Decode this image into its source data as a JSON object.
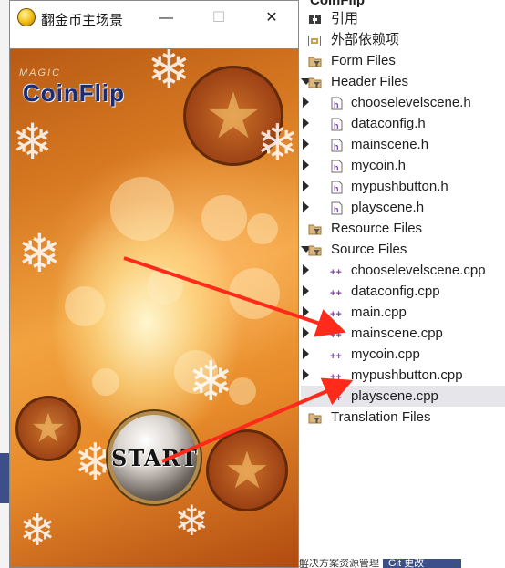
{
  "window": {
    "title": "翻金币主场景",
    "minimize": "—",
    "maximize": "☐",
    "close": "✕"
  },
  "scene": {
    "logo_top": "MAGIC",
    "logo": "CoinFlip",
    "start_button": "START"
  },
  "explorer": {
    "project": "CoinFlip",
    "items": [
      {
        "label": "引用",
        "icon": "references-icon"
      },
      {
        "label": "外部依赖项",
        "icon": "external-deps-icon"
      },
      {
        "label": "Form Files",
        "icon": "filter-folder-icon"
      },
      {
        "label": "Header Files",
        "icon": "filter-folder-icon"
      },
      {
        "label": "chooselevelscene.h",
        "icon": "header-file-icon"
      },
      {
        "label": "dataconfig.h",
        "icon": "header-file-icon"
      },
      {
        "label": "mainscene.h",
        "icon": "header-file-icon"
      },
      {
        "label": "mycoin.h",
        "icon": "header-file-icon"
      },
      {
        "label": "mypushbutton.h",
        "icon": "header-file-icon"
      },
      {
        "label": "playscene.h",
        "icon": "header-file-icon"
      },
      {
        "label": "Resource Files",
        "icon": "filter-folder-icon"
      },
      {
        "label": "Source Files",
        "icon": "filter-folder-icon"
      },
      {
        "label": "chooselevelscene.cpp",
        "icon": "cpp-file-icon"
      },
      {
        "label": "dataconfig.cpp",
        "icon": "cpp-file-icon"
      },
      {
        "label": "main.cpp",
        "icon": "cpp-file-icon"
      },
      {
        "label": "mainscene.cpp",
        "icon": "cpp-file-icon"
      },
      {
        "label": "mycoin.cpp",
        "icon": "cpp-file-icon"
      },
      {
        "label": "mypushbutton.cpp",
        "icon": "cpp-file-icon"
      },
      {
        "label": "playscene.cpp",
        "icon": "cpp-file-icon"
      },
      {
        "label": "Translation Files",
        "icon": "filter-folder-icon"
      }
    ],
    "bottom_tabs": [
      "解决方案资源管理器",
      "Git 更改"
    ]
  },
  "colors": {
    "annotation_arrow": "#ff2a1a",
    "selected_row": "#e5e5ea",
    "cpp_icon": "#8a3fb5",
    "header_icon": "#7a3fb0"
  }
}
